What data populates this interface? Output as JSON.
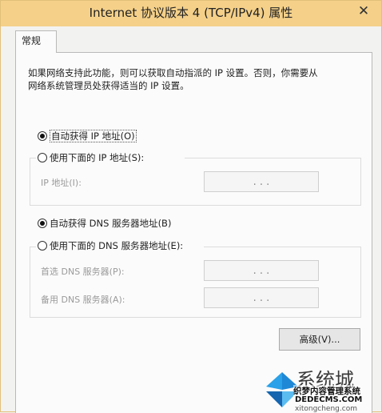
{
  "window": {
    "title": "Internet 协议版本 4 (TCP/IPv4) 属性",
    "close_glyph": "✕"
  },
  "tabs": [
    {
      "label": "常规",
      "selected": true
    }
  ],
  "description": {
    "line1": "如果网络支持此功能，则可以获取自动指派的 IP 设置。否则，你需要从",
    "line2": "网络系统管理员处获得适当的 IP 设置。"
  },
  "ip_section": {
    "auto_option": {
      "label": "自动获得 IP 地址(O)",
      "selected": true
    },
    "manual_option": {
      "label": "使用下面的 IP 地址(S):",
      "selected": false
    },
    "ip_address_label": "IP 地址(I):",
    "ip_address_value": ". . ."
  },
  "dns_section": {
    "auto_option": {
      "label": "自动获得 DNS 服务器地址(B)",
      "selected": true
    },
    "manual_option": {
      "label": "使用下面的 DNS 服务器地址(E):",
      "selected": false
    },
    "preferred_label": "首选 DNS 服务器(P):",
    "preferred_value": ". . .",
    "alternate_label": "备用 DNS 服务器(A):",
    "alternate_value": ". . ."
  },
  "advanced_button": {
    "label": "高级(V)..."
  },
  "watermark": {
    "brand": "系统城",
    "site_cn": "织梦内容管理系统",
    "site_domain": "DEDECMS.COM",
    "url": "xitongcheng.com",
    "logo_colors": [
      "#1e88d6",
      "#2aa1e8",
      "#1565b0",
      "#5bbcf0"
    ]
  }
}
